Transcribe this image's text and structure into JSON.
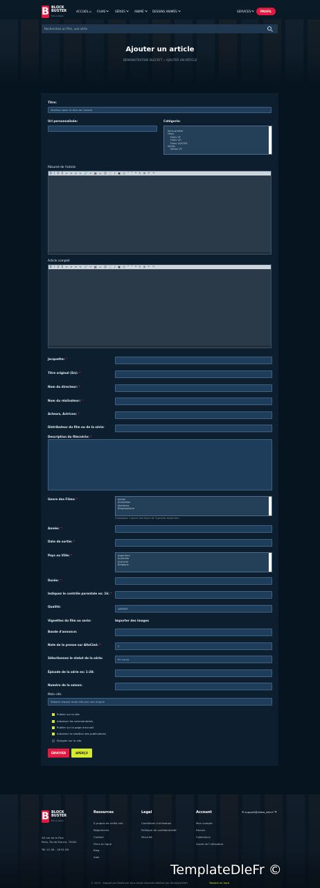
{
  "header": {
    "logo_letter": "B",
    "logo_line1": "BLOCK",
    "logo_line2": "BUSTER",
    "logo_tag": "Films & Séries",
    "nav": [
      "ACCUEIL",
      "FILMS",
      "SÉRIES",
      "ANIMÉ",
      "DESSINS ANIMÉS"
    ],
    "services": "SERVICES",
    "profil": "PROFIL"
  },
  "search": {
    "placeholder": "Recherchez un film, une série"
  },
  "page": {
    "title": "Ajouter un article",
    "breadcrumb": "DÉMONSTRATION DLECRFT » AJOUTER UN ARTICLE"
  },
  "form": {
    "title_label": "Titre:",
    "title_value": "Veuillez saisir le titre de l'article",
    "url_label": "Url personnalisée:",
    "category_label": "Catégorie:",
    "categories": [
      "Sans-prefixe",
      "Films",
      "Films VF",
      "Films VO",
      "Films VOSTFR",
      "Séries",
      "Séries VF"
    ],
    "summary_label": "Résumé de l'article",
    "full_label": "Article complet",
    "toolbar": "B I U S ≡ ≡ ≡ ≡ 🔗 ✂ ▦ ▭ ☺ ⬚ ♪ ▣ ◴ “ ” ❝ ✎ ⊞ ↶ ↷",
    "jacquette": "Jacquette:",
    "titre_original": "Titre original (En):",
    "directeur": "Nom du directeur:",
    "realisateur": "Nom du réalisateur:",
    "acteurs": "Acteurs, Actrices:",
    "distributeur": "Distributeur du film ou de la série:",
    "description": "Description du film/série:",
    "genre_label": "Genre des Films:",
    "genres": [
      "Action",
      "Animation",
      "Aventure",
      "Biographique"
    ],
    "genre_hint": "Choisissez 1 genre minimum et 3 genres maximum",
    "annee": "Année:",
    "sortie": "Date de sortie:",
    "pays_label": "Pays ou Ville:",
    "pays": [
      "Argentine",
      "Australie",
      "Autriche",
      "Belgique"
    ],
    "duree": "Durée:",
    "controle": "Indiquez le contrôle parentale ex: 16:",
    "qualite": "Qualité:",
    "qualite_value": "WEBRIP",
    "vignettes": "Vignettes du film ou serie:",
    "importer": "Importer des images",
    "bande": "Bande d'annonce:",
    "note": "Note de la presse sur AlloCiné:",
    "note_value": "0",
    "statut": "Sélectionnez le statut de la série:",
    "statut_value": "En cours",
    "episode": "Épisode de la série ex: 1-28:",
    "saison": "Numéro de la saison:",
    "mots_label": "Mots clés",
    "mots_value": "Séparé chaque mots clés par une virgule",
    "options": [
      "Publier sur le site",
      "Autoriser les commentaires",
      "Publier sur la page d'accueil",
      "Autoriser la notation des publications",
      "Épingler sur le site"
    ],
    "envoyer": "ENVOYER",
    "apercu": "APERÇU"
  },
  "footer": {
    "address": "28 rue de la Paix\nParis, Île-de-France, 75002",
    "phone": "Tél: 01 08 - 28 81 89",
    "resources_head": "Resources",
    "resources": [
      "À propos de vidéo info",
      "Règlements",
      "Contact",
      "Films en ligne",
      "Blog",
      "Aide"
    ],
    "legal_head": "Legal",
    "legal": [
      "Conditions d'utilisation",
      "Politique de confidentialité",
      "Sécurité"
    ],
    "account_head": "Account",
    "account": [
      "Mon compte",
      "Favoris",
      "Collections",
      "Guide de l'utilisateur"
    ],
    "email": "support@video_site.fr",
    "copyright": "© 2023 · Adapté par DleBLiver tous droits réservés Réalisé par TemplateDleFr",
    "back_top": "Revenir en haut",
    "watermark": "TemplateDleFr ©"
  },
  "colors": {
    "accent": "#e3193f",
    "green": "#d4ea2a",
    "bg": "#061420",
    "panel": "#0d1f2e",
    "input": "#1e3d5a"
  }
}
